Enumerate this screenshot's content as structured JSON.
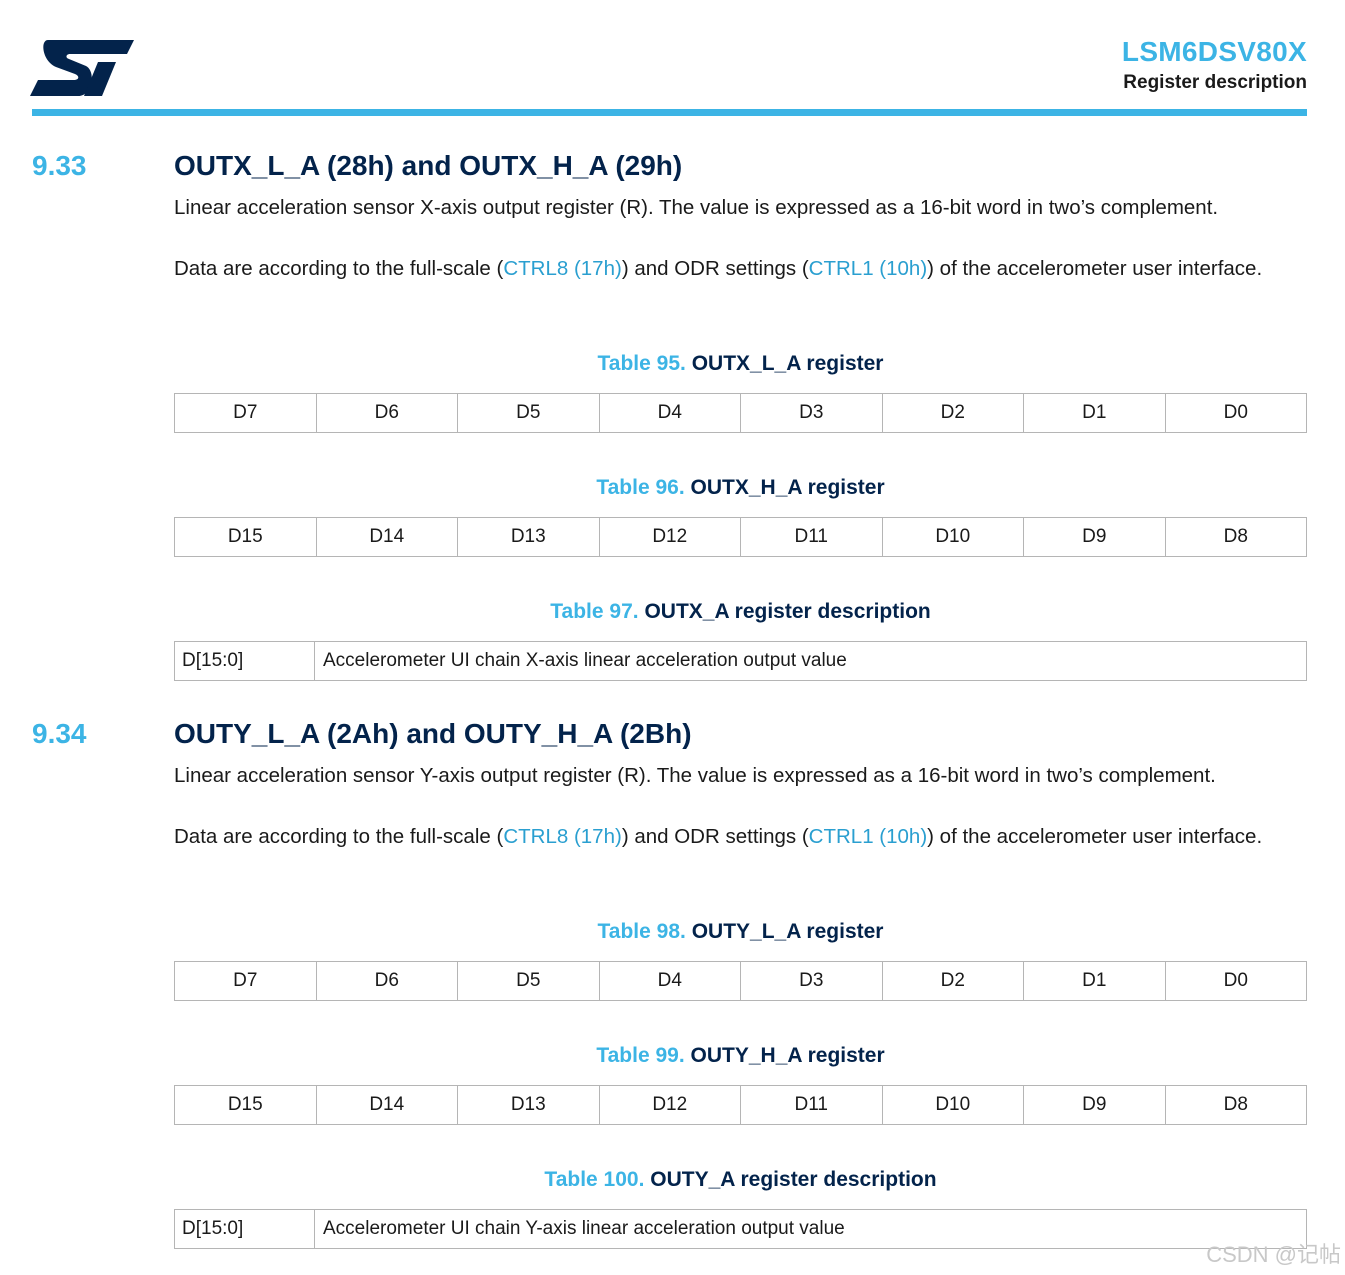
{
  "header": {
    "doc_title": "LSM6DSV80X",
    "doc_subtitle": "Register description",
    "logo_brand_color": "#03234B",
    "accent_color": "#3CB4E5"
  },
  "sections": [
    {
      "number": "9.33",
      "title": "OUTX_L_A (28h) and OUTX_H_A (29h)",
      "para1": "Linear acceleration sensor X-axis output register (R). The value is expressed as a 16-bit word in two’s complement.",
      "para2_a": "Data are according to the full-scale (",
      "para2_link1": "CTRL8 (17h)",
      "para2_b": ") and ODR settings (",
      "para2_link2": "CTRL1 (10h)",
      "para2_c": ") of the accelerometer user interface.",
      "tables": {
        "low": {
          "num": "Table 95.",
          "title": "OUTX_L_A register",
          "bits": [
            "D7",
            "D6",
            "D5",
            "D4",
            "D3",
            "D2",
            "D1",
            "D0"
          ]
        },
        "high": {
          "num": "Table 96.",
          "title": "OUTX_H_A register",
          "bits": [
            "D15",
            "D14",
            "D13",
            "D12",
            "D11",
            "D10",
            "D9",
            "D8"
          ]
        },
        "desc": {
          "num": "Table 97.",
          "title": "OUTX_A register description",
          "field": "D[15:0]",
          "text": "Accelerometer UI chain X-axis linear acceleration output value"
        }
      }
    },
    {
      "number": "9.34",
      "title": "OUTY_L_A (2Ah) and OUTY_H_A (2Bh)",
      "para1": "Linear acceleration sensor Y-axis output register (R). The value is expressed as a 16-bit word in two’s complement.",
      "para2_a": "Data are according to the full-scale (",
      "para2_link1": "CTRL8 (17h)",
      "para2_b": ") and ODR settings (",
      "para2_link2": "CTRL1 (10h)",
      "para2_c": ") of the accelerometer user interface.",
      "tables": {
        "low": {
          "num": "Table 98.",
          "title": "OUTY_L_A register",
          "bits": [
            "D7",
            "D6",
            "D5",
            "D4",
            "D3",
            "D2",
            "D1",
            "D0"
          ]
        },
        "high": {
          "num": "Table 99.",
          "title": "OUTY_H_A register",
          "bits": [
            "D15",
            "D14",
            "D13",
            "D12",
            "D11",
            "D10",
            "D9",
            "D8"
          ]
        },
        "desc": {
          "num": "Table 100.",
          "title": "OUTY_A register description",
          "field": "D[15:0]",
          "text": "Accelerometer UI chain Y-axis linear acceleration output value"
        }
      }
    }
  ],
  "watermark": "CSDN @记帖"
}
